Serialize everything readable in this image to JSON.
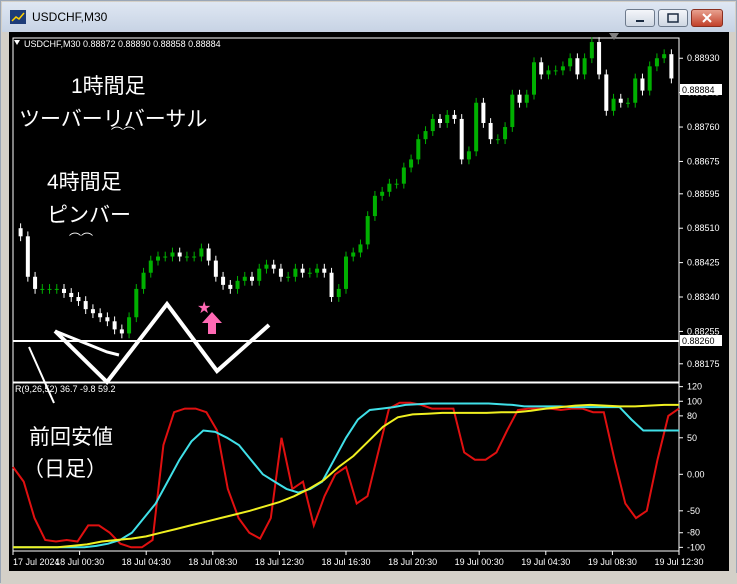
{
  "window": {
    "title": "USDCHF,M30"
  },
  "header": {
    "symbol_info": "USDCHF,M30  0.88872 0.88890 0.88858 0.88884",
    "indicator_info": "R(9,26,52) 36.7 -9.8 59.2"
  },
  "annotations": {
    "line1": "1時間足",
    "line2": "ツーバーリバーサル",
    "line3": "4時間足",
    "line4": "ピンバー",
    "line5": "前回安値",
    "line6": "（日足）"
  },
  "colors": {
    "background": "#000000",
    "bull_candle": "#00b000",
    "bear_candle": "#ffffff",
    "axis": "#ffffff",
    "red_line": "#e01010",
    "cyan_line": "#40e0e8",
    "yellow_line": "#f0f020",
    "star": "#ff69b4",
    "arrow": "#ff69b4"
  },
  "current_price": "0.88884",
  "support_price": "0.88260",
  "chart_data": [
    {
      "type": "candlestick",
      "symbol": "USDCHF",
      "timeframe": "M30",
      "ylim": [
        0.8813,
        0.8898
      ],
      "y_ticks": [
        "0.88930",
        "0.88845",
        "0.88760",
        "0.88675",
        "0.88595",
        "0.88510",
        "0.88425",
        "0.88340",
        "0.88255",
        "0.88175"
      ],
      "horizontal_line": 0.8826,
      "last_price": 0.88884,
      "close": [
        0.8849,
        0.8839,
        0.8836,
        0.8836,
        0.8836,
        0.8836,
        0.8835,
        0.8834,
        0.8833,
        0.8831,
        0.883,
        0.8829,
        0.8828,
        0.8826,
        0.8825,
        0.8829,
        0.8836,
        0.884,
        0.8843,
        0.8844,
        0.8844,
        0.8845,
        0.8844,
        0.8844,
        0.8844,
        0.8846,
        0.8843,
        0.8839,
        0.8837,
        0.8836,
        0.8838,
        0.8839,
        0.8838,
        0.8841,
        0.8842,
        0.8841,
        0.8839,
        0.8839,
        0.8841,
        0.884,
        0.884,
        0.8841,
        0.884,
        0.8834,
        0.8836,
        0.8844,
        0.8845,
        0.8847,
        0.8854,
        0.8859,
        0.886,
        0.8862,
        0.8862,
        0.8866,
        0.8868,
        0.8873,
        0.8875,
        0.8878,
        0.8877,
        0.8879,
        0.8878,
        0.8868,
        0.887,
        0.8882,
        0.8877,
        0.8873,
        0.8873,
        0.8876,
        0.8884,
        0.8882,
        0.8884,
        0.8892,
        0.8889,
        0.889,
        0.889,
        0.8891,
        0.8893,
        0.8889,
        0.8893,
        0.8897,
        0.8889,
        0.888,
        0.8883,
        0.8882,
        0.8882,
        0.8888,
        0.8885,
        0.8891,
        0.8893,
        0.8894,
        0.8888
      ],
      "open": [
        0.8851,
        0.8849,
        0.8839,
        0.8836,
        0.8836,
        0.8836,
        0.8836,
        0.8835,
        0.8834,
        0.8833,
        0.8831,
        0.883,
        0.8829,
        0.8828,
        0.8826,
        0.8825,
        0.8829,
        0.8836,
        0.884,
        0.8843,
        0.8844,
        0.8844,
        0.8845,
        0.8844,
        0.8844,
        0.8844,
        0.8846,
        0.8843,
        0.8839,
        0.8837,
        0.8836,
        0.8838,
        0.8839,
        0.8838,
        0.8841,
        0.8842,
        0.8841,
        0.8839,
        0.8839,
        0.8841,
        0.884,
        0.884,
        0.8841,
        0.884,
        0.8834,
        0.8836,
        0.8844,
        0.8845,
        0.8847,
        0.8854,
        0.8859,
        0.886,
        0.8862,
        0.8862,
        0.8866,
        0.8868,
        0.8873,
        0.8875,
        0.8878,
        0.8877,
        0.8879,
        0.8878,
        0.8868,
        0.887,
        0.8882,
        0.8877,
        0.8873,
        0.8873,
        0.8876,
        0.8884,
        0.8882,
        0.8884,
        0.8892,
        0.8889,
        0.889,
        0.889,
        0.8891,
        0.8893,
        0.8889,
        0.8893,
        0.8897,
        0.8889,
        0.888,
        0.8883,
        0.8882,
        0.8882,
        0.8888,
        0.8885,
        0.8891,
        0.8893,
        0.8894
      ]
    },
    {
      "type": "line",
      "title": "R(9,26,52) 36.7 -9.8 59.2",
      "ylim": [
        -105,
        125
      ],
      "y_ticks": [
        "120",
        "100",
        "80",
        "50",
        "0.00",
        "-50",
        "-80",
        "-100"
      ],
      "x_tick_labels": [
        "17 Jul 2024",
        "18 Jul 00:30",
        "18 Jul 04:30",
        "18 Jul 08:30",
        "18 Jul 12:30",
        "18 Jul 16:30",
        "18 Jul 20:30",
        "19 Jul 00:30",
        "19 Jul 04:30",
        "19 Jul 08:30",
        "19 Jul 12:30"
      ],
      "series": [
        {
          "color": "#e01010",
          "values": [
            10,
            -10,
            -60,
            -90,
            -92,
            -90,
            -92,
            -70,
            -70,
            -80,
            -95,
            -100,
            -100,
            -90,
            40,
            85,
            90,
            90,
            85,
            60,
            -20,
            -60,
            -80,
            -88,
            -60,
            50,
            -20,
            -10,
            -70,
            -30,
            0,
            10,
            -40,
            -30,
            30,
            90,
            98,
            98,
            95,
            90,
            90,
            90,
            30,
            20,
            20,
            30,
            60,
            88,
            90,
            90,
            90,
            88,
            90,
            90,
            85,
            85,
            20,
            -40,
            -60,
            -50,
            20,
            80,
            90
          ]
        },
        {
          "color": "#40e0e8",
          "values": [
            -100,
            -100,
            -100,
            -100,
            -100,
            -100,
            -100,
            -98,
            -95,
            -90,
            -80,
            -60,
            -40,
            -10,
            20,
            45,
            60,
            58,
            50,
            40,
            20,
            0,
            -10,
            -20,
            -25,
            -20,
            -10,
            20,
            50,
            75,
            88,
            90,
            92,
            95,
            96,
            97,
            97,
            97,
            97,
            97,
            97,
            96,
            95,
            93,
            93,
            93,
            93,
            92,
            92,
            92,
            92,
            92,
            75,
            60,
            60,
            60,
            60
          ]
        },
        {
          "color": "#f0f020",
          "values": [
            -100,
            -100,
            -100,
            -100,
            -98,
            -96,
            -92,
            -90,
            -88,
            -85,
            -80,
            -75,
            -70,
            -65,
            -60,
            -55,
            -50,
            -44,
            -38,
            -30,
            -20,
            -8,
            10,
            25,
            45,
            65,
            78,
            82,
            83,
            84,
            84,
            84,
            84,
            85,
            85,
            87,
            90,
            92,
            94,
            95,
            94,
            93,
            93,
            94,
            95,
            95
          ]
        }
      ]
    }
  ]
}
